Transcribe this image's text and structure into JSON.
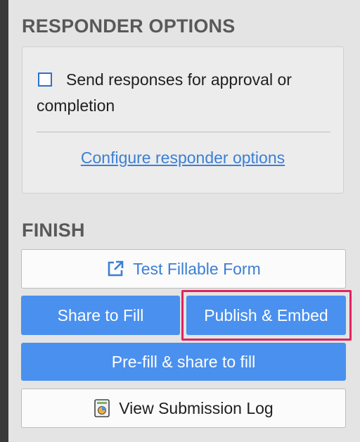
{
  "responder": {
    "title": "RESPONDER OPTIONS",
    "checkbox_label": "Send responses for approval or completion",
    "checkbox_checked": false,
    "configure_link": "Configure responder options"
  },
  "finish": {
    "title": "FINISH",
    "test_button": "Test Fillable Form",
    "share_button": "Share to Fill",
    "publish_button": "Publish & Embed",
    "prefill_button": "Pre-fill & share to fill",
    "log_button": "View Submission Log"
  },
  "icons": {
    "test": "external-link-icon",
    "log": "spreadsheet-chart-icon"
  },
  "colors": {
    "primary_blue": "#4a90ee",
    "link_blue": "#3b7fd4",
    "highlight": "#e0245e"
  }
}
